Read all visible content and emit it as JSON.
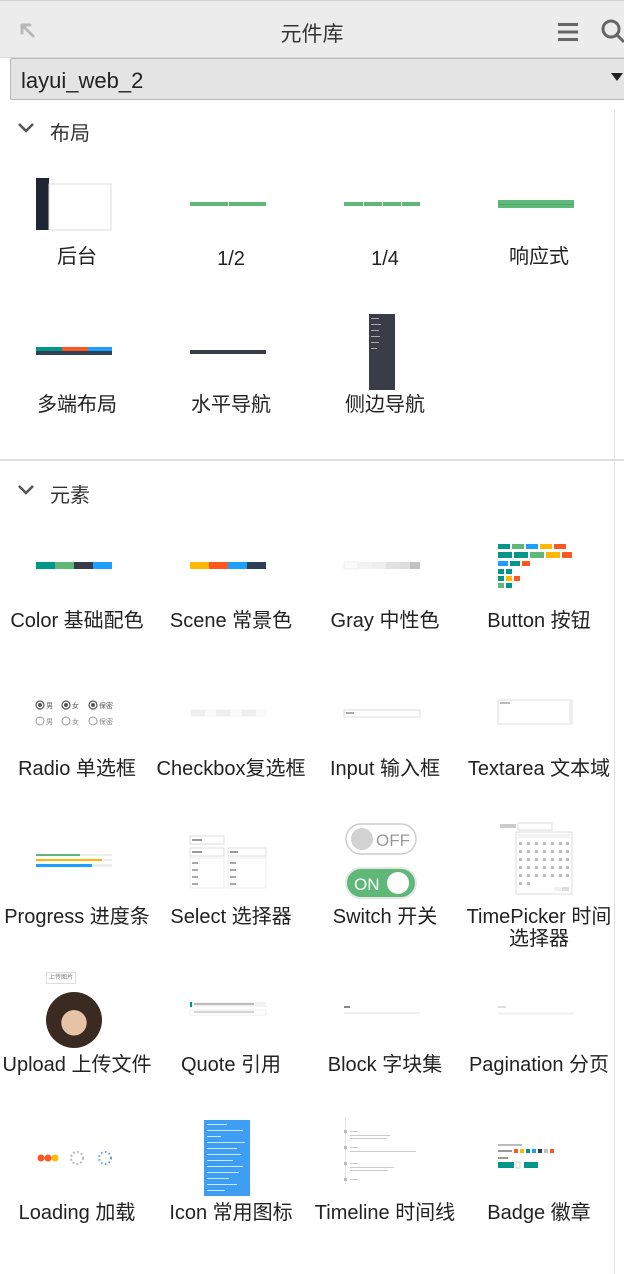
{
  "panel": {
    "title": "元件库",
    "library": "layui_web_2"
  },
  "sections": [
    {
      "label": "布局",
      "items": [
        "后台",
        "1/2",
        "1/4",
        "响应式",
        "多端布局",
        "水平导航",
        "侧边导航"
      ]
    },
    {
      "label": "元素",
      "items": [
        "Color 基础配色",
        "Scene 常景色",
        "Gray 中性色",
        "Button 按钮",
        "Radio 单选框",
        "Checkbox复选框",
        "Input 输入框",
        "Textarea 文本域",
        "Progress 进度条",
        "Select 选择器",
        "Switch 开关",
        "TimePicker 时间选择器",
        "Upload 上传文件",
        "Quote 引用",
        "Block 字块集",
        "Pagination 分页",
        "Loading 加载",
        "Icon 常用图标",
        "Timeline 时间线",
        "Badge 徽章"
      ]
    }
  ],
  "thumbs": {
    "radio_labels": [
      "男",
      "女",
      "保密",
      "男",
      "女",
      "保密"
    ],
    "switch_off": "OFF",
    "switch_on": "ON",
    "upload_btn": "上传图片"
  },
  "icons": [
    "back-arrow-icon",
    "menu-icon",
    "search-icon",
    "chevron-down-icon",
    "dropdown-caret-icon"
  ],
  "colors": {
    "layui_green": "#5fb878",
    "layui_dark": "#2f4056",
    "layui_red": "#ff5722",
    "layui_blue": "#1e9fff",
    "layui_orange": "#ffb800",
    "teal": "#009688"
  }
}
